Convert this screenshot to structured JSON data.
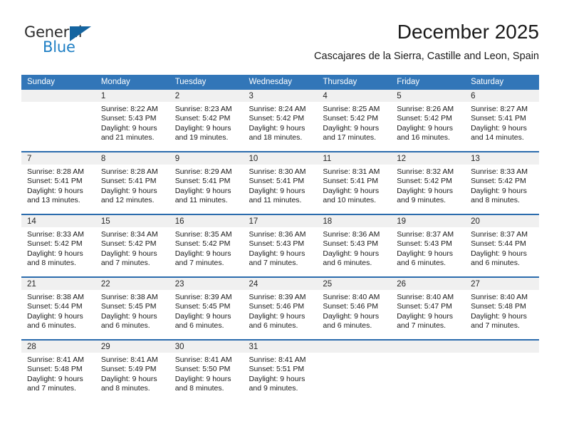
{
  "logo": {
    "word_top": "General",
    "word_bottom": "Blue",
    "accent_color": "#1464a0",
    "text_color": "#2b2b2b",
    "blue_text_color": "#1f7fc4"
  },
  "header": {
    "title": "December 2025",
    "subtitle": "Cascajares de la Sierra, Castille and Leon, Spain"
  },
  "theme": {
    "header_bg": "#3276b8",
    "row_divider": "#2b6cad",
    "daynum_band_bg": "#f0f0f0"
  },
  "weekday_headers": [
    "Sunday",
    "Monday",
    "Tuesday",
    "Wednesday",
    "Thursday",
    "Friday",
    "Saturday"
  ],
  "weeks": [
    [
      {
        "day": "",
        "empty": true,
        "l1": "",
        "l2": "",
        "l3": "",
        "l4": ""
      },
      {
        "day": "1",
        "l1": "Sunrise: 8:22 AM",
        "l2": "Sunset: 5:43 PM",
        "l3": "Daylight: 9 hours",
        "l4": "and 21 minutes."
      },
      {
        "day": "2",
        "l1": "Sunrise: 8:23 AM",
        "l2": "Sunset: 5:42 PM",
        "l3": "Daylight: 9 hours",
        "l4": "and 19 minutes."
      },
      {
        "day": "3",
        "l1": "Sunrise: 8:24 AM",
        "l2": "Sunset: 5:42 PM",
        "l3": "Daylight: 9 hours",
        "l4": "and 18 minutes."
      },
      {
        "day": "4",
        "l1": "Sunrise: 8:25 AM",
        "l2": "Sunset: 5:42 PM",
        "l3": "Daylight: 9 hours",
        "l4": "and 17 minutes."
      },
      {
        "day": "5",
        "l1": "Sunrise: 8:26 AM",
        "l2": "Sunset: 5:42 PM",
        "l3": "Daylight: 9 hours",
        "l4": "and 16 minutes."
      },
      {
        "day": "6",
        "l1": "Sunrise: 8:27 AM",
        "l2": "Sunset: 5:41 PM",
        "l3": "Daylight: 9 hours",
        "l4": "and 14 minutes."
      }
    ],
    [
      {
        "day": "7",
        "l1": "Sunrise: 8:28 AM",
        "l2": "Sunset: 5:41 PM",
        "l3": "Daylight: 9 hours",
        "l4": "and 13 minutes."
      },
      {
        "day": "8",
        "l1": "Sunrise: 8:28 AM",
        "l2": "Sunset: 5:41 PM",
        "l3": "Daylight: 9 hours",
        "l4": "and 12 minutes."
      },
      {
        "day": "9",
        "l1": "Sunrise: 8:29 AM",
        "l2": "Sunset: 5:41 PM",
        "l3": "Daylight: 9 hours",
        "l4": "and 11 minutes."
      },
      {
        "day": "10",
        "l1": "Sunrise: 8:30 AM",
        "l2": "Sunset: 5:41 PM",
        "l3": "Daylight: 9 hours",
        "l4": "and 11 minutes."
      },
      {
        "day": "11",
        "l1": "Sunrise: 8:31 AM",
        "l2": "Sunset: 5:41 PM",
        "l3": "Daylight: 9 hours",
        "l4": "and 10 minutes."
      },
      {
        "day": "12",
        "l1": "Sunrise: 8:32 AM",
        "l2": "Sunset: 5:42 PM",
        "l3": "Daylight: 9 hours",
        "l4": "and 9 minutes."
      },
      {
        "day": "13",
        "l1": "Sunrise: 8:33 AM",
        "l2": "Sunset: 5:42 PM",
        "l3": "Daylight: 9 hours",
        "l4": "and 8 minutes."
      }
    ],
    [
      {
        "day": "14",
        "l1": "Sunrise: 8:33 AM",
        "l2": "Sunset: 5:42 PM",
        "l3": "Daylight: 9 hours",
        "l4": "and 8 minutes."
      },
      {
        "day": "15",
        "l1": "Sunrise: 8:34 AM",
        "l2": "Sunset: 5:42 PM",
        "l3": "Daylight: 9 hours",
        "l4": "and 7 minutes."
      },
      {
        "day": "16",
        "l1": "Sunrise: 8:35 AM",
        "l2": "Sunset: 5:42 PM",
        "l3": "Daylight: 9 hours",
        "l4": "and 7 minutes."
      },
      {
        "day": "17",
        "l1": "Sunrise: 8:36 AM",
        "l2": "Sunset: 5:43 PM",
        "l3": "Daylight: 9 hours",
        "l4": "and 7 minutes."
      },
      {
        "day": "18",
        "l1": "Sunrise: 8:36 AM",
        "l2": "Sunset: 5:43 PM",
        "l3": "Daylight: 9 hours",
        "l4": "and 6 minutes."
      },
      {
        "day": "19",
        "l1": "Sunrise: 8:37 AM",
        "l2": "Sunset: 5:43 PM",
        "l3": "Daylight: 9 hours",
        "l4": "and 6 minutes."
      },
      {
        "day": "20",
        "l1": "Sunrise: 8:37 AM",
        "l2": "Sunset: 5:44 PM",
        "l3": "Daylight: 9 hours",
        "l4": "and 6 minutes."
      }
    ],
    [
      {
        "day": "21",
        "l1": "Sunrise: 8:38 AM",
        "l2": "Sunset: 5:44 PM",
        "l3": "Daylight: 9 hours",
        "l4": "and 6 minutes."
      },
      {
        "day": "22",
        "l1": "Sunrise: 8:38 AM",
        "l2": "Sunset: 5:45 PM",
        "l3": "Daylight: 9 hours",
        "l4": "and 6 minutes."
      },
      {
        "day": "23",
        "l1": "Sunrise: 8:39 AM",
        "l2": "Sunset: 5:45 PM",
        "l3": "Daylight: 9 hours",
        "l4": "and 6 minutes."
      },
      {
        "day": "24",
        "l1": "Sunrise: 8:39 AM",
        "l2": "Sunset: 5:46 PM",
        "l3": "Daylight: 9 hours",
        "l4": "and 6 minutes."
      },
      {
        "day": "25",
        "l1": "Sunrise: 8:40 AM",
        "l2": "Sunset: 5:46 PM",
        "l3": "Daylight: 9 hours",
        "l4": "and 6 minutes."
      },
      {
        "day": "26",
        "l1": "Sunrise: 8:40 AM",
        "l2": "Sunset: 5:47 PM",
        "l3": "Daylight: 9 hours",
        "l4": "and 7 minutes."
      },
      {
        "day": "27",
        "l1": "Sunrise: 8:40 AM",
        "l2": "Sunset: 5:48 PM",
        "l3": "Daylight: 9 hours",
        "l4": "and 7 minutes."
      }
    ],
    [
      {
        "day": "28",
        "l1": "Sunrise: 8:41 AM",
        "l2": "Sunset: 5:48 PM",
        "l3": "Daylight: 9 hours",
        "l4": "and 7 minutes."
      },
      {
        "day": "29",
        "l1": "Sunrise: 8:41 AM",
        "l2": "Sunset: 5:49 PM",
        "l3": "Daylight: 9 hours",
        "l4": "and 8 minutes."
      },
      {
        "day": "30",
        "l1": "Sunrise: 8:41 AM",
        "l2": "Sunset: 5:50 PM",
        "l3": "Daylight: 9 hours",
        "l4": "and 8 minutes."
      },
      {
        "day": "31",
        "l1": "Sunrise: 8:41 AM",
        "l2": "Sunset: 5:51 PM",
        "l3": "Daylight: 9 hours",
        "l4": "and 9 minutes."
      },
      {
        "day": "",
        "empty": true,
        "l1": "",
        "l2": "",
        "l3": "",
        "l4": ""
      },
      {
        "day": "",
        "empty": true,
        "l1": "",
        "l2": "",
        "l3": "",
        "l4": ""
      },
      {
        "day": "",
        "empty": true,
        "l1": "",
        "l2": "",
        "l3": "",
        "l4": ""
      }
    ]
  ]
}
